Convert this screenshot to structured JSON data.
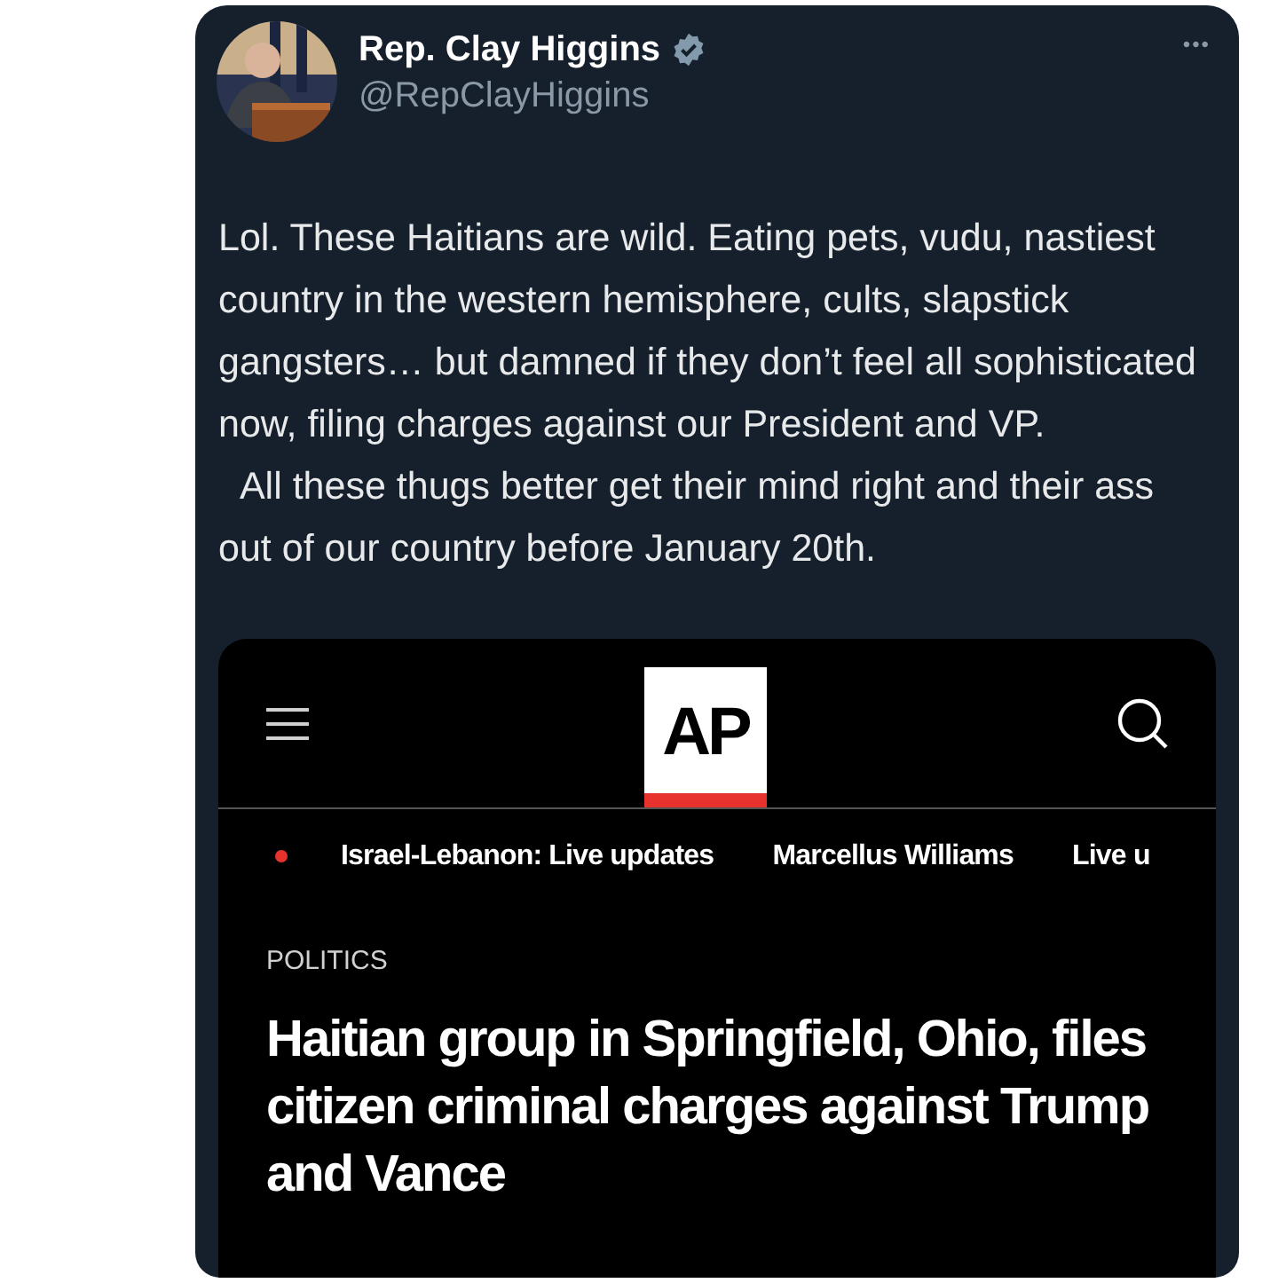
{
  "author": {
    "name": "Rep. Clay Higgins",
    "verified": true,
    "handle": "@RepClayHiggins"
  },
  "more_button": "•••",
  "body": [
    "Lol. These Haitians are wild. Eating pets, vudu, nastiest country in the western hemisphere, cults, slapstick gangsters… but damned if they don’t feel all sophisticated now, filing charges against our President and VP.",
    "  All these thugs better get their mind right and their ass out of our country before January 20th."
  ],
  "embed": {
    "logo": "AP",
    "nav_items": [
      {
        "label": "Israel-Lebanon: Live updates",
        "live": true
      },
      {
        "label": "Marcellus Williams",
        "live": false
      },
      {
        "label": "Live u",
        "live": false
      }
    ],
    "section": "POLITICS",
    "headline": "Haitian group in Springfield, Ohio, files citizen criminal charges against Trump and Vance"
  }
}
